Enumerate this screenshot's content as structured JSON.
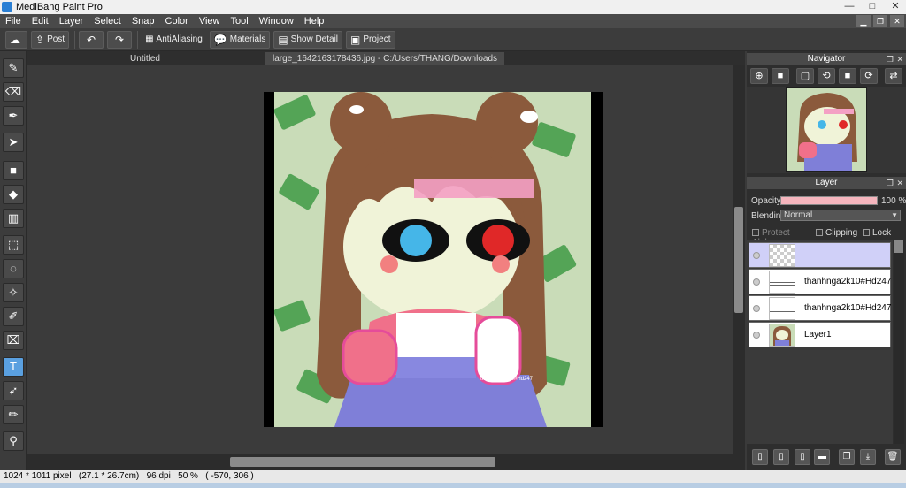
{
  "window": {
    "title": "MediBang Paint Pro",
    "controls": [
      "—",
      "□",
      "✕"
    ]
  },
  "menu": [
    "File",
    "Edit",
    "Layer",
    "Select",
    "Snap",
    "Color",
    "View",
    "Tool",
    "Window",
    "Help"
  ],
  "toolbar": {
    "post_label": "Post",
    "antialiasing_label": "AntiAliasing",
    "materials_label": "Materials",
    "show_detail_label": "Show Detail",
    "project_label": "Project"
  },
  "tabs": [
    {
      "label": "Untitled",
      "active": false
    },
    {
      "label": "large_1642163178436.jpg - C:/Users/THANG/Downloads",
      "active": true
    }
  ],
  "artwork": {
    "watermark": "thanhnga2k10#Hd247"
  },
  "navigator": {
    "title": "Navigator"
  },
  "layer_panel": {
    "title": "Layer",
    "opacity_label": "Opacity",
    "opacity_value": "100 %",
    "opacity_fraction": 1.0,
    "blending_label": "Blending",
    "blending_value": "Normal",
    "protect_alpha_label": "Protect Alpha",
    "clipping_label": "Clipping",
    "lock_label": "Lock",
    "layers": [
      {
        "name": "",
        "thumb": "checker",
        "selected": true
      },
      {
        "name": "thanhnga2k10#Hd247",
        "thumb": "text",
        "selected": false
      },
      {
        "name": "thanhnga2k10#Hd247",
        "thumb": "text",
        "selected": false
      },
      {
        "name": "Layer1",
        "thumb": "image",
        "selected": false
      }
    ]
  },
  "status": {
    "text": "1024 * 1011 pixel   (27.1 * 26.7cm)   96 dpi   50 %   ( -570, 306 )"
  },
  "colors": {
    "accent": "#5aa0e0",
    "opacity_bar": "#f5b5bd",
    "selected_layer": "#d0d0f8",
    "hair": "#8b5a3c",
    "money_bg": "#c9dcb8"
  }
}
